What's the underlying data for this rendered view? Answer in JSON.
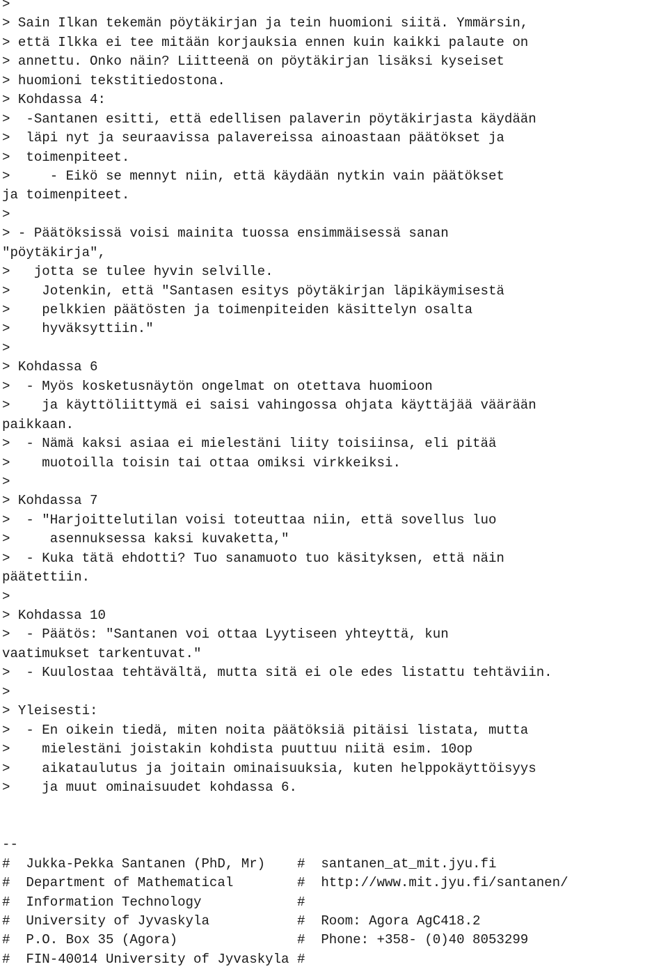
{
  "document": {
    "type": "plain-text-email-quote",
    "background_color": "#ffffff",
    "text_color": "#1a1a1a",
    "quote_prefix": ">",
    "signature_prefix": "#",
    "signature_separator": "--"
  },
  "body_lines": [
    ">",
    "> Sain Ilkan tekemän pöytäkirjan ja tein huomioni siitä. Ymmärsin,",
    "> että Ilkka ei tee mitään korjauksia ennen kuin kaikki palaute on",
    "> annettu. Onko näin? Liitteenä on pöytäkirjan lisäksi kyseiset",
    "> huomioni tekstitiedostona.",
    "> Kohdassa 4:",
    ">  -Santanen esitti, että edellisen palaverin pöytäkirjasta käydään",
    ">  läpi nyt ja seuraavissa palavereissa ainoastaan päätökset ja",
    ">  toimenpiteet.",
    ">     - Eikö se mennyt niin, että käydään nytkin vain päätökset",
    "ja toimenpiteet.",
    ">",
    "> - Päätöksissä voisi mainita tuossa ensimmäisessä sanan",
    "\"pöytäkirja\",",
    ">   jotta se tulee hyvin selville.",
    ">    Jotenkin, että \"Santasen esitys pöytäkirjan läpikäymisestä",
    ">    pelkkien päätösten ja toimenpiteiden käsittelyn osalta",
    ">    hyväksyttiin.\"",
    ">",
    "> Kohdassa 6",
    ">  - Myös kosketusnäytön ongelmat on otettava huomioon",
    ">    ja käyttöliittymä ei saisi vahingossa ohjata käyttäjää väärään",
    "paikkaan.",
    ">  - Nämä kaksi asiaa ei mielestäni liity toisiinsa, eli pitää",
    ">    muotoilla toisin tai ottaa omiksi virkkeiksi.",
    ">",
    "> Kohdassa 7",
    ">  - \"Harjoittelutilan voisi toteuttaa niin, että sovellus luo",
    ">     asennuksessa kaksi kuvaketta,\"",
    ">  - Kuka tätä ehdotti? Tuo sanamuoto tuo käsityksen, että näin",
    "päätettiin.",
    ">",
    "> Kohdassa 10",
    ">  - Päätös: \"Santanen voi ottaa Lyytiseen yhteyttä, kun",
    "vaatimukset tarkentuvat.\"",
    ">  - Kuulostaa tehtävältä, mutta sitä ei ole edes listattu tehtäviin.",
    ">",
    "> Yleisesti:",
    ">  - En oikein tiedä, miten noita päätöksiä pitäisi listata, mutta",
    ">    mielestäni joistakin kohdista puuttuu niitä esim. 10op",
    ">    aikataulutus ja joitain ominaisuuksia, kuten helppokäyttöisyys",
    ">    ja muut ominaisuudet kohdassa 6.",
    "",
    "",
    "--"
  ],
  "signature": {
    "separator": "--",
    "lines": [
      "#  Jukka-Pekka Santanen (PhD, Mr)    #  santanen_at_mit.jyu.fi",
      "#  Department of Mathematical        #  http://www.mit.jyu.fi/santanen/",
      "#  Information Technology            #",
      "#  University of Jyvaskyla           #  Room: Agora AgC418.2",
      "#  P.O. Box 35 (Agora)               #  Phone: +358- (0)40 8053299",
      "#  FIN-40014 University of Jyvaskyla #"
    ],
    "fields": {
      "name": "Jukka-Pekka Santanen (PhD, Mr)",
      "department_line_1": "Department of Mathematical",
      "department_line_2": "Information Technology",
      "university": "University of Jyvaskyla",
      "po_box": "P.O. Box 35 (Agora)",
      "postal": "FIN-40014 University of Jyvaskyla",
      "email": "santanen_at_mit.jyu.fi",
      "homepage": "http://www.mit.jyu.fi/santanen/",
      "room": "Room: Agora AgC418.2",
      "phone": "Phone: +358- (0)40 8053299"
    }
  }
}
